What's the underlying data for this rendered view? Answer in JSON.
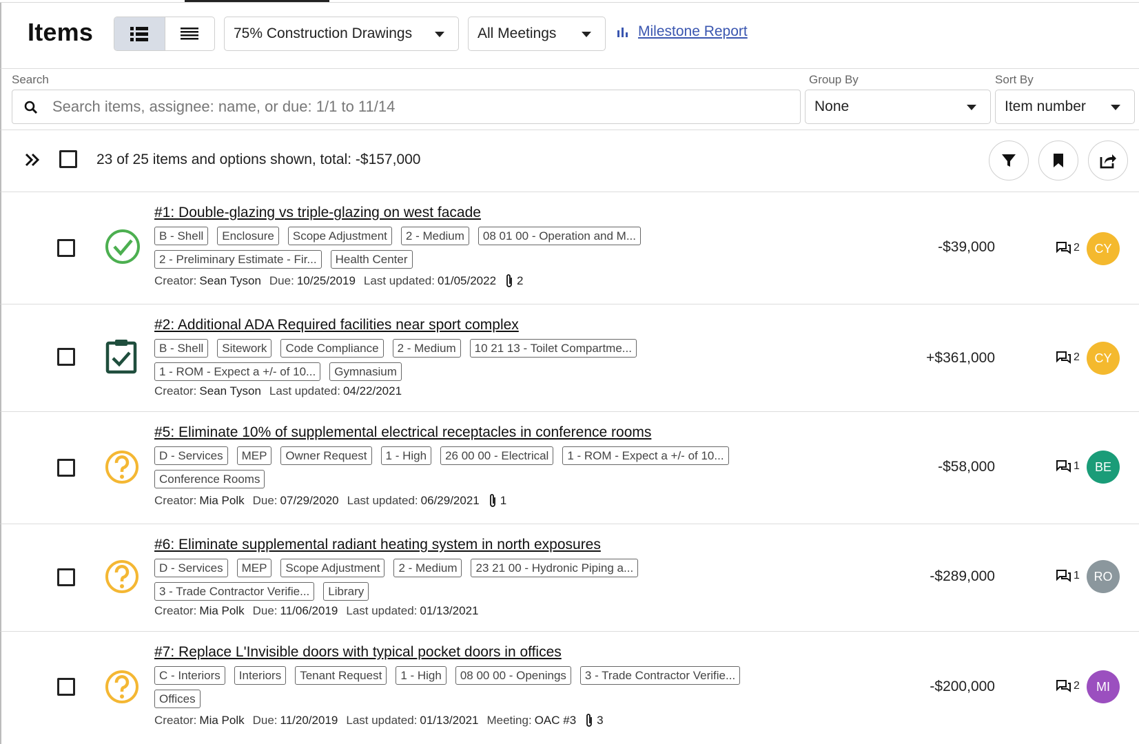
{
  "header": {
    "title": "Items",
    "milestone_select": "75% Construction Drawings",
    "meetings_select": "All Meetings",
    "report_link": "Milestone Report"
  },
  "search": {
    "label": "Search",
    "placeholder": "Search items, assignee: name, or due: 1/1 to 11/14",
    "group_by_label": "Group By",
    "group_by_value": "None",
    "sort_by_label": "Sort By",
    "sort_by_value": "Item number"
  },
  "summary": {
    "text": "23 of 25 items and options shown, total: -$157,000"
  },
  "colors": {
    "accepted": "#4caf50",
    "decided": "#1f4e3d",
    "pending": "#f4b733",
    "link": "#3a56b0"
  },
  "items": [
    {
      "title": "#1: Double-glazing vs triple-glazing on west facade",
      "status_icon": "check-circle-icon",
      "tags": [
        "B - Shell",
        "Enclosure",
        "Scope Adjustment",
        "2 - Medium",
        "08 01 00 - Operation and M...",
        "2 - Preliminary Estimate - Fir...",
        "Health Center"
      ],
      "creator_label": "Creator:",
      "creator": "Sean Tyson",
      "due_label": "Due:",
      "due": "10/25/2019",
      "updated_label": "Last updated:",
      "updated": "01/05/2022",
      "attachments": "2",
      "amount": "-$39,000",
      "comments": "2",
      "avatar": "CY",
      "avatar_color": "#f4b92e"
    },
    {
      "title": "#2: Additional ADA Required facilities near sport complex",
      "status_icon": "clipboard-check-icon",
      "tags": [
        "B - Shell",
        "Sitework",
        "Code Compliance",
        "2 - Medium",
        "10 21 13 - Toilet Compartme...",
        "1 - ROM - Expect a +/- of 10...",
        "Gymnasium"
      ],
      "creator_label": "Creator:",
      "creator": "Sean Tyson",
      "updated_label": "Last updated:",
      "updated": "04/22/2021",
      "amount": "+$361,000",
      "comments": "2",
      "avatar": "CY",
      "avatar_color": "#f4b92e"
    },
    {
      "title": "#5: Eliminate 10% of supplemental electrical receptacles in conference rooms",
      "status_icon": "question-circle-icon",
      "tags": [
        "D - Services",
        "MEP",
        "Owner Request",
        "1 - High",
        "26 00 00 - Electrical",
        "1 - ROM - Expect a +/- of 10...",
        "Conference Rooms"
      ],
      "creator_label": "Creator:",
      "creator": "Mia Polk",
      "due_label": "Due:",
      "due": "07/29/2020",
      "updated_label": "Last updated:",
      "updated": "06/29/2021",
      "attachments": "1",
      "amount": "-$58,000",
      "comments": "1",
      "avatar": "BE",
      "avatar_color": "#1a9c78"
    },
    {
      "title": "#6: Eliminate supplemental radiant heating system in north exposures",
      "status_icon": "question-circle-icon",
      "tags": [
        "D - Services",
        "MEP",
        "Scope Adjustment",
        "2 - Medium",
        "23 21 00 - Hydronic Piping a...",
        "3 - Trade Contractor Verifie...",
        "Library"
      ],
      "creator_label": "Creator:",
      "creator": "Mia Polk",
      "due_label": "Due:",
      "due": "11/06/2019",
      "updated_label": "Last updated:",
      "updated": "01/13/2021",
      "amount": "-$289,000",
      "comments": "1",
      "avatar": "RO",
      "avatar_color": "#8b979d"
    },
    {
      "title": "#7: Replace L'Invisible doors with typical pocket doors in offices",
      "status_icon": "question-circle-icon",
      "tags": [
        "C - Interiors",
        "Interiors",
        "Tenant Request",
        "1 - High",
        "08 00 00 - Openings",
        "3 - Trade Contractor Verifie...",
        "Offices"
      ],
      "creator_label": "Creator:",
      "creator": "Mia Polk",
      "due_label": "Due:",
      "due": "11/20/2019",
      "updated_label": "Last updated:",
      "updated": "01/13/2021",
      "meeting_label": "Meeting:",
      "meeting": "OAC #3",
      "attachments": "3",
      "amount": "-$200,000",
      "comments": "2",
      "avatar": "MI",
      "avatar_color": "#9b4fbf"
    }
  ]
}
